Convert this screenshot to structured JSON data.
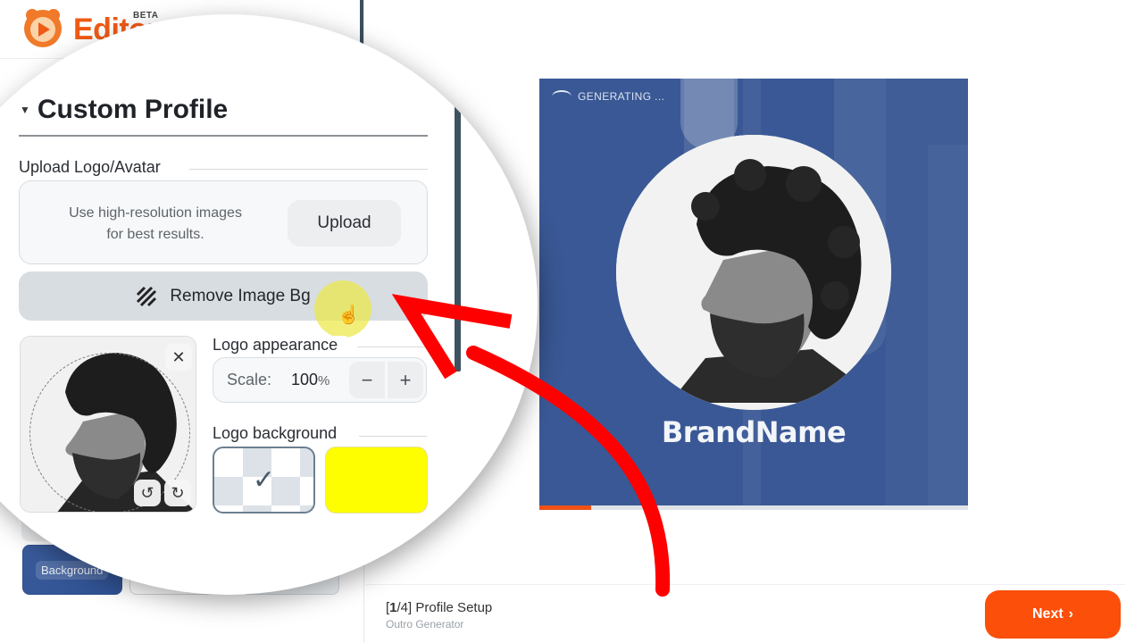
{
  "app": {
    "name": "Editor",
    "badge": "BETA",
    "brand_color": "#ef5a14"
  },
  "panel": {
    "section_title": "Custom Profile",
    "upload": {
      "label": "Upload Logo/Avatar",
      "hint_line1": "Use high-resolution images",
      "hint_line2": "for best results.",
      "button": "Upload"
    },
    "remove_bg_button": "Remove Image Bg",
    "logo_appearance": {
      "label": "Logo appearance",
      "scale_label": "Scale:",
      "scale_value": "100",
      "scale_unit": "%",
      "decrement": "−",
      "increment": "+"
    },
    "logo_background": {
      "label": "Logo background",
      "options": [
        {
          "name": "transparent",
          "selected": true
        },
        {
          "name": "yellow",
          "color": "#fefe00",
          "selected": false
        }
      ]
    },
    "card_controls": {
      "remove": "✕",
      "rotate_left": "↺",
      "rotate_right": "↻"
    },
    "background_tile_label": "Background"
  },
  "preview": {
    "status": "GENERATING ...",
    "brand_name": "BrandName",
    "bg_color": "#3a5895",
    "progress_percent": 12
  },
  "footer": {
    "step_current": "1",
    "step_total": "/4]",
    "step_open": "[",
    "step_title": "Profile Setup",
    "subtitle": "Outro Generator",
    "next_button": "Next",
    "next_chevron": "›",
    "accent": "#fb4f0a"
  }
}
